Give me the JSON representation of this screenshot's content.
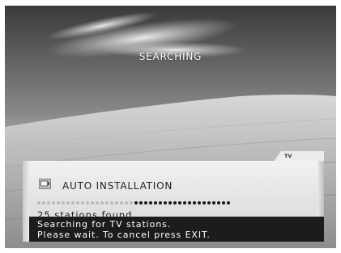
{
  "screen": {
    "overlay_title": "SEARCHING"
  },
  "panel": {
    "tab_label": "TV",
    "icon": "tv-set-icon",
    "title": "AUTO INSTALLATION",
    "progress": {
      "completed_fraction": 0.5,
      "total_dots": 40
    },
    "status_count": "25 stations found",
    "message_line1": "Searching for TV stations.",
    "message_line2": "Please wait. To cancel press EXIT."
  },
  "colors": {
    "dot_done": "#1a1a1a",
    "dot_pending": "#b9b9b9",
    "message_bar": "#1c1c1c"
  }
}
